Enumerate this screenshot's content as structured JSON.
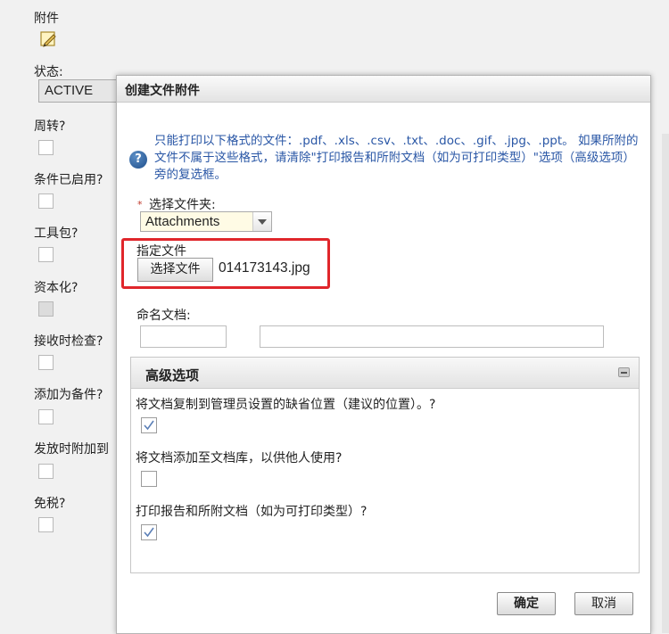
{
  "background": {
    "attachments_label": "附件",
    "attachments_icon": "edit-attachment-icon",
    "status_label": "状态:",
    "status_value": "ACTIVE",
    "fields": [
      {
        "label": "周转?",
        "disabled": false
      },
      {
        "label": "条件已启用?",
        "disabled": false
      },
      {
        "label": "工具包?",
        "disabled": false
      },
      {
        "label": "资本化?",
        "disabled": true
      },
      {
        "label": "接收时检查?",
        "disabled": false
      },
      {
        "label": "添加为备件?",
        "disabled": false
      },
      {
        "label": "发放时附加到",
        "disabled": false
      },
      {
        "label": "免税?",
        "disabled": false
      }
    ]
  },
  "dialog": {
    "title": "创建文件附件",
    "info_icon": "help-info-icon",
    "info_text": "只能打印以下格式的文件：.pdf、.xls、.csv、.txt、.doc、.gif、.jpg、.ppt。 如果所附的文件不属于这些格式，请清除\"打印报告和所附文档（如为可打印类型）\"选项（高级选项）旁的复选框。",
    "required_marker": "*",
    "folder_label": "选择文件夹:",
    "folder_value": "Attachments",
    "specify_file_label": "指定文件",
    "choose_file_button": "选择文件",
    "file_name": "014173143.jpg",
    "name_doc_label": "命名文档:",
    "advanced": {
      "title": "高级选项",
      "options": [
        {
          "label": "将文档复制到管理员设置的缺省位置（建议的位置）。?",
          "checked": true
        },
        {
          "label": "将文档添加至文档库，以供他人使用?",
          "checked": false
        },
        {
          "label": "打印报告和所附文档（如为可打印类型）?",
          "checked": true
        }
      ]
    },
    "ok_button": "确定",
    "cancel_button": "取消"
  },
  "colors": {
    "highlight_border": "#e0262b",
    "info_text": "#2a57a6",
    "checkmark": "#5b7fb6"
  }
}
